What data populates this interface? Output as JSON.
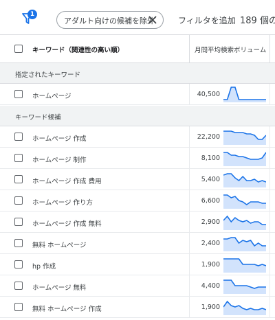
{
  "filterbar": {
    "badge": "1",
    "chip_label": "アダルト向けの候補を除外",
    "add_filter_label": "フィルタを追加",
    "count_text": "189 個の"
  },
  "table": {
    "col_keyword": "キーワード（関連性の高い順）",
    "col_volume": "月間平均検索ボリューム"
  },
  "sections": {
    "specified": "指定されたキーワード",
    "suggestions": "キーワード候補"
  },
  "specified_rows": [
    {
      "keyword": "ホームページ",
      "volume": "40,500",
      "trend": [
        0.1,
        0.1,
        1.0,
        1.0,
        0.1,
        0.1,
        0.1,
        0.1,
        0.1,
        0.1,
        0.1,
        0.1
      ]
    }
  ],
  "suggestion_rows": [
    {
      "keyword": "ホームページ 作成",
      "volume": "22,200",
      "trend": [
        0.9,
        0.9,
        0.9,
        0.8,
        0.8,
        0.8,
        0.7,
        0.7,
        0.6,
        0.3,
        0.3,
        0.6
      ]
    },
    {
      "keyword": "ホームページ 制作",
      "volume": "8,100",
      "trend": [
        0.9,
        0.9,
        0.7,
        0.7,
        0.6,
        0.6,
        0.5,
        0.4,
        0.4,
        0.4,
        0.5,
        0.9
      ]
    },
    {
      "keyword": "ホームページ 作成 費用",
      "volume": "5,400",
      "trend": [
        0.8,
        0.9,
        0.9,
        0.6,
        0.4,
        0.7,
        0.4,
        0.4,
        0.5,
        0.3,
        0.4,
        0.3
      ]
    },
    {
      "keyword": "ホームページ 作り方",
      "volume": "6,600",
      "trend": [
        0.9,
        0.9,
        0.7,
        0.8,
        0.5,
        0.4,
        0.2,
        0.4,
        0.4,
        0.4,
        0.3,
        0.3
      ]
    },
    {
      "keyword": "ホームページ 作成 無料",
      "volume": "2,900",
      "trend": [
        0.6,
        0.9,
        0.5,
        0.8,
        0.6,
        0.5,
        0.6,
        0.4,
        0.5,
        0.5,
        0.3,
        0.3
      ]
    },
    {
      "keyword": "無料 ホームページ",
      "volume": "2,400",
      "trend": [
        0.8,
        0.8,
        0.9,
        0.9,
        0.5,
        0.7,
        0.6,
        0.7,
        0.3,
        0.5,
        0.3,
        0.3
      ]
    },
    {
      "keyword": "hp 作成",
      "volume": "1,900",
      "trend": [
        0.9,
        0.9,
        0.9,
        0.9,
        0.9,
        0.5,
        0.5,
        0.5,
        0.5,
        0.4,
        0.5,
        0.4
      ]
    },
    {
      "keyword": "ホームページ 無料",
      "volume": "4,400",
      "trend": [
        0.9,
        0.9,
        0.9,
        0.5,
        0.5,
        0.5,
        0.5,
        0.4,
        0.3,
        0.4,
        0.4,
        0.4
      ]
    },
    {
      "keyword": "無料 ホームページ 作成",
      "volume": "1,900",
      "trend": [
        0.5,
        0.9,
        0.6,
        0.5,
        0.6,
        0.4,
        0.3,
        0.4,
        0.3,
        0.3,
        0.4,
        0.3
      ]
    }
  ],
  "colors": {
    "accent": "#1a73e8",
    "spark_fill": "#d2e3fc"
  },
  "icons": {
    "filter": "filter-icon",
    "chip_close": "close-icon",
    "checkbox": "checkbox"
  }
}
